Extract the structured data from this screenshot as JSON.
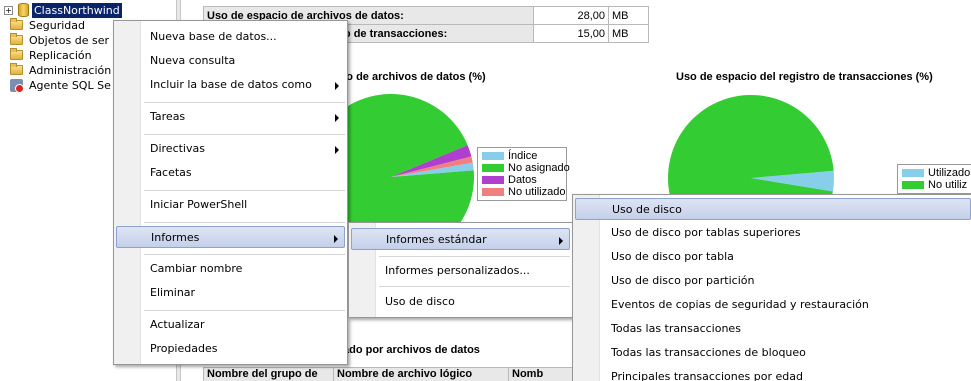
{
  "tree": {
    "items": [
      {
        "label": "ClassNorthwind",
        "icon": "database-icon",
        "selected": true
      },
      {
        "label": "Seguridad",
        "icon": "folder-icon"
      },
      {
        "label": "Objetos de ser",
        "icon": "folder-icon"
      },
      {
        "label": "Replicación",
        "icon": "folder-icon"
      },
      {
        "label": "Administración",
        "icon": "folder-icon"
      },
      {
        "label": "Agente SQL Se",
        "icon": "sql-agent-icon"
      }
    ],
    "expander_glyph": "+"
  },
  "report": {
    "summary": [
      {
        "label": "Uso de espacio de archivos de datos:",
        "value": "28,00",
        "unit": "MB"
      },
      {
        "label": "Uso de espacio del registro de transacciones:",
        "value": "15,00",
        "unit": "MB"
      }
    ],
    "chart_data": [
      {
        "type": "pie",
        "title": "Uso de espacio de archivos de datos (%)",
        "slices": [
          {
            "label": "Índice",
            "value": 1.5,
            "color": "#87ceeb"
          },
          {
            "label": "No asignado",
            "value": 95.0,
            "color": "#33cc33"
          },
          {
            "label": "Datos",
            "value": 2.3,
            "color": "#b03fd0"
          },
          {
            "label": "No utilizado",
            "value": 1.2,
            "color": "#f08080"
          }
        ],
        "legend_position": "right"
      },
      {
        "type": "pie",
        "title": "Uso de espacio del registro de transacciones (%)",
        "slices": [
          {
            "label": "Utilizado",
            "value": 4,
            "color": "#87ceeb"
          },
          {
            "label": "No utilizado",
            "value": 96,
            "color": "#33cc33"
          }
        ],
        "legend_position": "right"
      }
    ],
    "legend1": [
      "Índice",
      "No asignado",
      "Datos",
      "No utilizado"
    ],
    "legend2": [
      "Utilizado",
      "No utiliz"
    ],
    "title1_visible": "acio de archivos de datos (%)",
    "title2_visible": "Uso de espacio del registro de transacciones (%)",
    "section_title_visible": "ado por archivos de datos",
    "filegroup_headers": [
      "Nombre del grupo de",
      "Nombre de archivo lógico",
      "Nomb"
    ]
  },
  "menu_main": {
    "items": [
      {
        "label": "Nueva base de datos...",
        "submenu": false
      },
      {
        "label": "Nueva consulta",
        "submenu": false
      },
      {
        "label": "Incluir la base de datos como",
        "submenu": true
      },
      {
        "label": "Tareas",
        "submenu": true
      },
      {
        "label": "Directivas",
        "submenu": true
      },
      {
        "label": "Facetas",
        "submenu": false
      },
      {
        "label": "Iniciar PowerShell",
        "submenu": false
      },
      {
        "label": "Informes",
        "submenu": true,
        "highlighted": true
      },
      {
        "label": "Cambiar nombre",
        "submenu": false
      },
      {
        "label": "Eliminar",
        "submenu": false
      },
      {
        "label": "Actualizar",
        "submenu": false
      },
      {
        "label": "Propiedades",
        "submenu": false
      }
    ]
  },
  "menu_reports": {
    "items": [
      {
        "label": "Informes estándar",
        "submenu": true,
        "highlighted": true
      },
      {
        "label": "Informes personalizados...",
        "submenu": false
      },
      {
        "label": "Uso de disco",
        "submenu": false
      }
    ]
  },
  "menu_standard": {
    "items": [
      {
        "label": "Uso de disco",
        "highlighted": true
      },
      {
        "label": "Uso de disco por tablas superiores"
      },
      {
        "label": "Uso de disco por tabla"
      },
      {
        "label": "Uso de disco por partición"
      },
      {
        "label": "Eventos de copias de seguridad y restauración"
      },
      {
        "label": "Todas las transacciones"
      },
      {
        "label": "Todas las transacciones de bloqueo"
      },
      {
        "label": "Principales transacciones por edad"
      }
    ]
  },
  "colors": {
    "selection": "#0a246a",
    "menu_highlight": "#c4d0ea",
    "pie_green": "#33cc33"
  }
}
